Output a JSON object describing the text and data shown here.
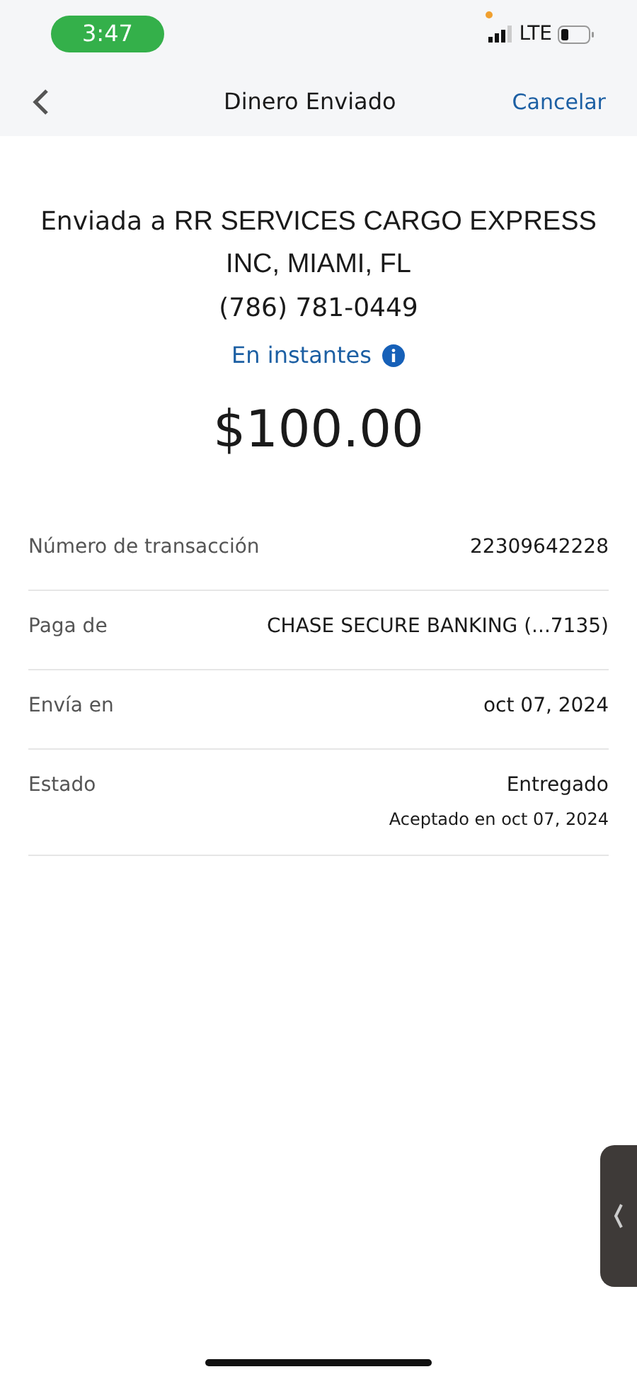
{
  "status_bar": {
    "time": "3:47",
    "network": "LTE"
  },
  "header": {
    "title": "Dinero Enviado",
    "action": "Cancelar"
  },
  "summary": {
    "prefix": "Enviada a",
    "recipient": "RR SERVICES CARGO EXPRESS INC, MIAMI, FL",
    "phone": "(786) 781-0449",
    "speed": "En instantes",
    "amount": "$100.00"
  },
  "details": [
    {
      "label": "Número de transacción",
      "value": "22309642228"
    },
    {
      "label": "Paga de",
      "value": "CHASE SECURE BANKING (...7135)"
    },
    {
      "label": "Envía en",
      "value": "oct 07, 2024"
    },
    {
      "label": "Estado",
      "value": "Entregado",
      "note": "Aceptado en oct 07, 2024"
    }
  ]
}
